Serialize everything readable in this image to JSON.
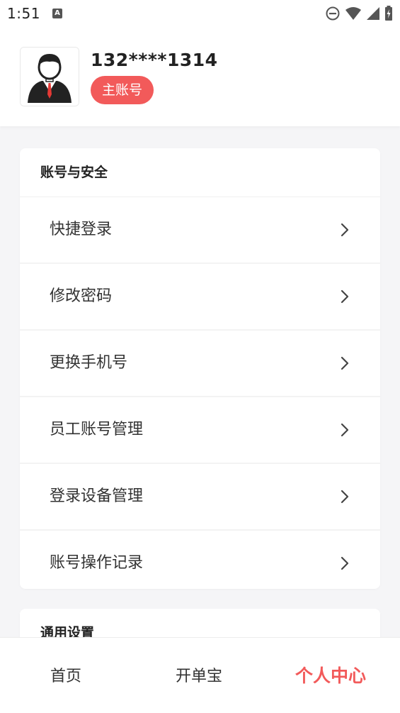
{
  "status_bar": {
    "time": "1:51",
    "notification_icon": "a-icon",
    "icons": [
      "dnd-icon",
      "wifi-icon",
      "signal-icon",
      "battery-charging-icon"
    ]
  },
  "profile": {
    "phone": "132****1314",
    "badge": "主账号",
    "avatar_icon": "person-suit-icon"
  },
  "security_section": {
    "title": "账号与安全",
    "items": [
      {
        "label": "快捷登录"
      },
      {
        "label": "修改密码"
      },
      {
        "label": "更换手机号"
      },
      {
        "label": "员工账号管理"
      },
      {
        "label": "登录设备管理"
      },
      {
        "label": "账号操作记录"
      }
    ]
  },
  "general_section": {
    "title": "通用设置"
  },
  "tab_bar": {
    "tabs": [
      {
        "label": "首页"
      },
      {
        "label": "开单宝"
      },
      {
        "label": "个人中心"
      }
    ],
    "active": "个人中心"
  },
  "colors": {
    "accent": "#f25a5a",
    "background": "#f5f5f7"
  }
}
